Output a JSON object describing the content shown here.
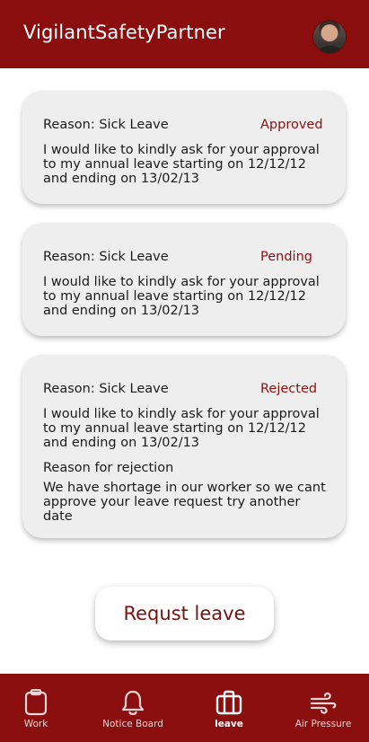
{
  "header": {
    "title": "VigilantSafetyPartner"
  },
  "requests": [
    {
      "reason": "Reason: Sick Leave",
      "status": "Approved",
      "message": "I would like to kindly ask for your approval to my  annual leave starting on 12/12/12 and ending on 13/02/13"
    },
    {
      "reason": "Reason: Sick Leave",
      "status": "Pending",
      "message": "I would like to kindly ask for your approval to my  annual leave starting on 12/12/12 and ending on 13/02/13"
    },
    {
      "reason": "Reason: Sick Leave",
      "status": "Rejected",
      "message": "I would like to kindly ask for your approval to my  annual leave starting on 12/12/12 and ending on 13/02/13",
      "rejection_title": "Reason for rejection",
      "rejection_text": "We have shortage in our worker so we cant approve your leave request try another date"
    }
  ],
  "request_button": "Requst leave",
  "nav": {
    "items": [
      {
        "label": "Work",
        "icon": "clipboard-icon"
      },
      {
        "label": "Notice Board",
        "icon": "bell-icon"
      },
      {
        "label": "leave",
        "icon": "briefcase-icon",
        "active": true
      },
      {
        "label": "Air Pressure",
        "icon": "wind-icon"
      }
    ]
  },
  "colors": {
    "brand": "#8b0e0e",
    "status": "#8b1010",
    "card": "#eeeeee"
  }
}
